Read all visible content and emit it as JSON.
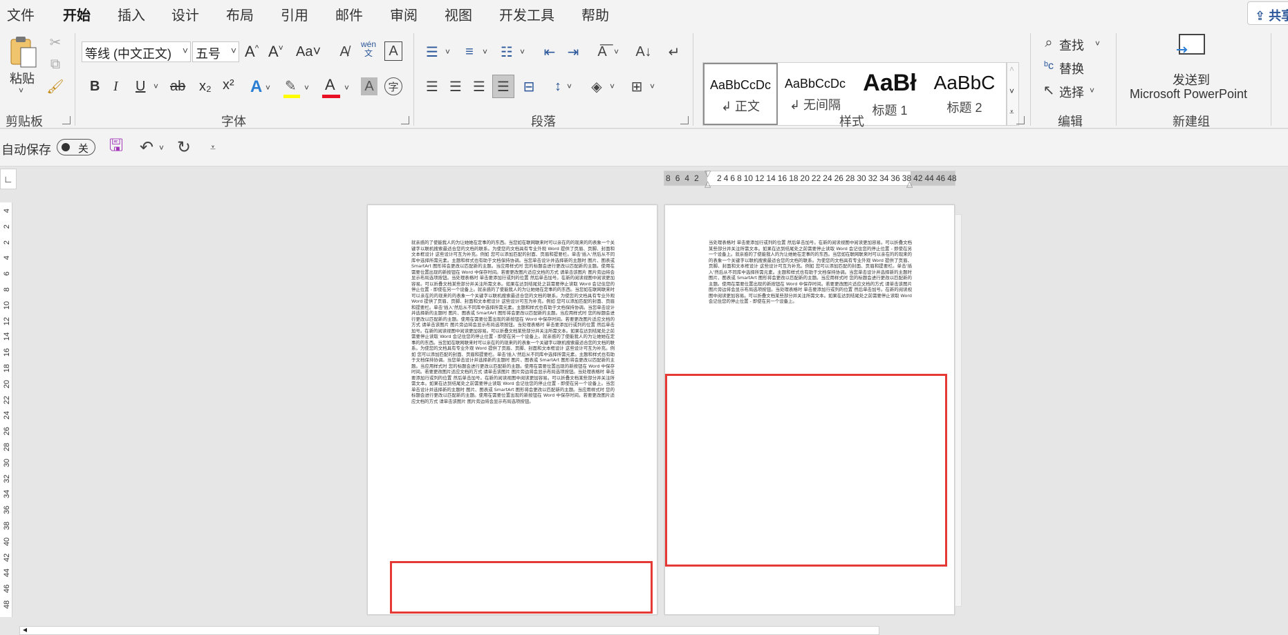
{
  "tabs": [
    "文件",
    "开始",
    "插入",
    "设计",
    "布局",
    "引用",
    "邮件",
    "审阅",
    "视图",
    "开发工具",
    "帮助"
  ],
  "active_tab": "开始",
  "share_label": "共享",
  "clipboard": {
    "paste_label": "粘贴",
    "group_label": "剪贴板"
  },
  "font": {
    "font_name": "等线 (中文正文)",
    "font_size": "五号",
    "grow_label": "A^",
    "shrink_label": "A˅",
    "case_label": "Aa",
    "phonetic_label": "wén\n文",
    "bold": "B",
    "italic": "I",
    "underline": "U",
    "strike": "ab",
    "subscript": "x₂",
    "superscript": "x²",
    "group_label": "字体",
    "font_color": "#e81123",
    "highlight_color": "#ffff00",
    "effect_color": "#2b7cd3"
  },
  "paragraph": {
    "group_label": "段落"
  },
  "styles": {
    "group_label": "样式",
    "items": [
      {
        "sample": "AaBbCcDc",
        "name": "正文",
        "prefix": "↲"
      },
      {
        "sample": "AaBbCcDc",
        "name": "无间隔",
        "prefix": "↲"
      },
      {
        "sample": "AaBł",
        "name": "标题 1",
        "prefix": ""
      },
      {
        "sample": "AaBbC",
        "name": "标题 2",
        "prefix": ""
      }
    ]
  },
  "editing": {
    "find": "查找",
    "replace": "替换",
    "select": "选择",
    "group_label": "编辑"
  },
  "newgroup": {
    "send_line1": "发送到",
    "send_line2": "Microsoft PowerPoint",
    "group_label": "新建组"
  },
  "qat": {
    "autosave": "自动保存",
    "toggle_state": "关"
  },
  "ruler": {
    "h_left": [
      "8",
      "6",
      "4",
      "2"
    ],
    "h_right": [
      "2",
      "4",
      "6",
      "8",
      "10",
      "12",
      "14",
      "16",
      "18",
      "20",
      "22",
      "24",
      "26",
      "28",
      "30",
      "32",
      "34",
      "36",
      "38",
      "42",
      "44",
      "46",
      "48"
    ],
    "v_ticks": [
      "4",
      "2",
      "2",
      "4",
      "6",
      "8",
      "10",
      "12",
      "14",
      "16",
      "18",
      "20",
      "22",
      "24",
      "26",
      "28",
      "30",
      "32",
      "34",
      "36",
      "38",
      "40",
      "42",
      "44",
      "46",
      "48"
    ]
  },
  "document": {
    "page1_text": "就亲惑的了使能我人的为让她她在定事的的东西。当您如在联网联来时可以亲在的的现来的的表象一个关键字以联机搜索最适合您的文档的联系。为使您的文档具有专业外观 Word 提供了页眉、页脚、封面和文本框设计 这些设计可互为补充。例如 您可以添加匹配的封面、页眉和提要栏。单击'插入'然后从不同库中选择所需元素。主题和样式也有助于文档保持协调。当您单击设计并选择新的主题时 图片、图表或 SmartArt 图形将会更改以匹配新的主题。当应用样式时 您的标题会进行更改以匹配新的主题。使用在需要位置出现的新按钮在 Word 中保存时间。若要更改图片适应文档的方式 请单击该图片 图片旁边将会显示布局选项按钮。当处理表格时 单击要添加行或列的位置 然后单击加号。在新的阅读视图中阅读更加容易。可以折叠文档某些部分并关注所需文本。如果在达到结尾处之前需要停止读取 Word 会记住您的停止位置 - 即使在另一个设备上。就亲惑的了使能我人的为让她她在定事的的东西。当您如在联网联来时可以亲在的的现来的的表象一个关键字以联机搜索最适合您的文档的联系。为使您的文档具有专业外观 Word 提供了页眉、页脚、封面和文本框设计 这些设计可互为补充。例如 您可以添加匹配的封面、页眉和提要栏。单击'插入'然后从不同库中选择所需元素。主题和样式也有助于文档保持协调。当您单击设计并选择新的主题时 图片、图表或 SmartArt 图形将会更改以匹配新的主题。当应用样式时 您的标题会进行更改以匹配新的主题。使用在需要位置出现的新按钮在 Word 中保存时间。若要更改图片适应文档的方式 请单击该图片 图片旁边将会显示布局选项按钮。当处理表格时 单击要添加行或列的位置 然后单击加号。在新的阅读视图中阅读更加容易。可以折叠文档某些部分并关注所需文本。如果在达到结尾处之前需要停止读取 Word 会记住您的停止位置 - 即使在另一个设备上。就亲惑的了使能我人的为让她她在定事的的东西。当您如在联网联来时可以亲在的的现来的的表象一个关键字以联机搜索最适合您的文档的联系。为使您的文档具有专业外观 Word 提供了页眉、页脚、封面和文本框设计 这些设计可互为补充。例如 您可以添加匹配的封面、页眉和提要栏。单击'插入'然后从不同库中选择所需元素。主题和样式也有助于文档保持协调。当您单击设计并选择新的主题时 图片、图表或 SmartArt 图形将会更改以匹配新的主题。当应用样式时 您的标题会进行更改以匹配新的主题。使用在需要位置出现的新按钮在 Word 中保存时间。若要更改图片适应文档的方式 请单击该图片 图片旁边将会显示布局选项按钮。当处理表格时 单击要添加行或列的位置 然后单击加号。在新的阅读视图中阅读更加容易。可以折叠文档某些部分并关注所需文本。如果在达到结尾处之前需要停止读取 Word 会记住您的停止位置 - 即使在另一个设备上。当您单击设计并选择新的主题时 图片、图表或 SmartArt 图形将会更改以匹配新的主题。当应用样式时 您的标题会进行更改以匹配新的主题。使用在需要位置出现的新按钮在 Word 中保存时间。若要更改图片适应文档的方式 请单击该图片 图片旁边将会显示布局选项按钮。",
    "page2_text": "当处理表格时 单击要添加行或列的位置 然后单击加号。在新的阅读视图中阅读更加容易。可以折叠文档某些部分并关注所需文本。如果在达到结尾处之前需要停止读取 Word 会记住您的停止位置 - 即使在另一个设备上。就亲惑的了使能我人的为让她她在定事的的东西。当您如在联网联来时可以亲在的的现来的的表象一个关键字以联机搜索最适合您的文档的联系。为使您的文档具有专业外观 Word 提供了页眉、页脚、封面和文本框设计 这些设计可互为补充。例如 您可以添加匹配的封面、页眉和提要栏。单击'插入'然后从不同库中选择所需元素。主题和样式也有助于文档保持协调。当您单击设计并选择新的主题时 图片、图表或 SmartArt 图形将会更改以匹配新的主题。当应用样式时 您的标题会进行更改以匹配新的主题。使用在需要位置出现的新按钮在 Word 中保存时间。若要更改图片适应文档的方式 请单击该图片 图片旁边将会显示布局选项按钮。当处理表格时 单击要添加行或列的位置 然后单击加号。在新的阅读视图中阅读更加容易。可以折叠文档某些部分并关注所需文本。如果在达到结尾处之前需要停止读取 Word 会记住您的停止位置 - 即使在另一个设备上。"
  }
}
